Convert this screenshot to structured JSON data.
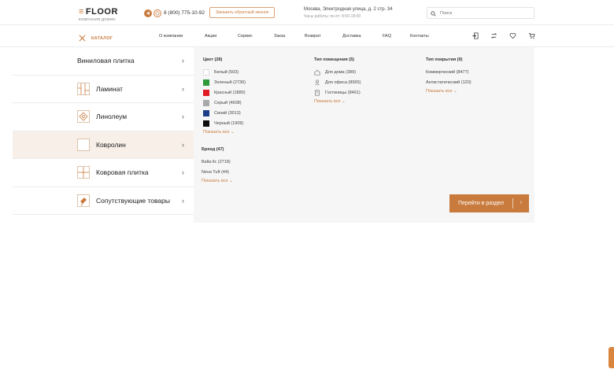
{
  "header": {
    "logo_mark": "≡",
    "logo_text": "FLOOR",
    "logo_sub": "КОМПАНИЯ ДОМИО",
    "phone": "8 (800) 775-10-92",
    "callback_label": "Заказать обратный звонок",
    "address": "Москва, Электродная улица, д. 2 стр. 34",
    "hours": "Часы работы: пн-пт: 8:00-18:00",
    "search_placeholder": "Поиск",
    "icons": [
      "telegram-icon",
      "whatsapp-icon",
      "search-icon"
    ]
  },
  "nav": {
    "catalog_label": "КАТАЛОГ",
    "items": [
      "О компании",
      "Акции",
      "Сервис",
      "Заказ",
      "Возврат",
      "Доставка",
      "FAQ",
      "Контакты"
    ],
    "icons": [
      "login-icon",
      "compare-icon",
      "heart-icon",
      "cart-icon"
    ]
  },
  "categories": [
    {
      "label": "Виниловая плитка"
    },
    {
      "label": "Ламинат"
    },
    {
      "label": "Линолеум"
    },
    {
      "label": "Ковролин"
    },
    {
      "label": "Ковровая плитка"
    },
    {
      "label": "Сопутствующие товары"
    }
  ],
  "filters": {
    "color": {
      "title": "Цвет (28)",
      "options": [
        {
          "label": "Белый (593)",
          "color": "#ffffff"
        },
        {
          "label": "Зеленый (2736)",
          "color": "#2e9a3a"
        },
        {
          "label": "Красный (1880)",
          "color": "#e11b22"
        },
        {
          "label": "Серый (4608)",
          "color": "#a9a9ad"
        },
        {
          "label": "Синий (3013)",
          "color": "#1d3f8a"
        },
        {
          "label": "Черный (1909)",
          "color": "#0d0d0d"
        }
      ],
      "show_all": "Показать все"
    },
    "room": {
      "title": "Тип помещения (5)",
      "options": [
        {
          "label": "Для дома (389)",
          "icon": "house-icon"
        },
        {
          "label": "Для офиса (8065)",
          "icon": "office-chair-icon"
        },
        {
          "label": "Гостиницы (8461)",
          "icon": "hotel-icon"
        }
      ],
      "show_all": "Показать все"
    },
    "coating": {
      "title": "Тип покрытия (9)",
      "options": [
        {
          "label": "Коммерческий (8477)"
        },
        {
          "label": "Антистатический (120)"
        }
      ],
      "show_all": "Показать все"
    },
    "brand": {
      "title": "Бренд (47)",
      "options": [
        {
          "label": "Balta llc (2718)"
        },
        {
          "label": "Neva Tuft (44)"
        }
      ],
      "show_all": "Показать все"
    }
  },
  "go_button_label": "Перейти в раздел"
}
